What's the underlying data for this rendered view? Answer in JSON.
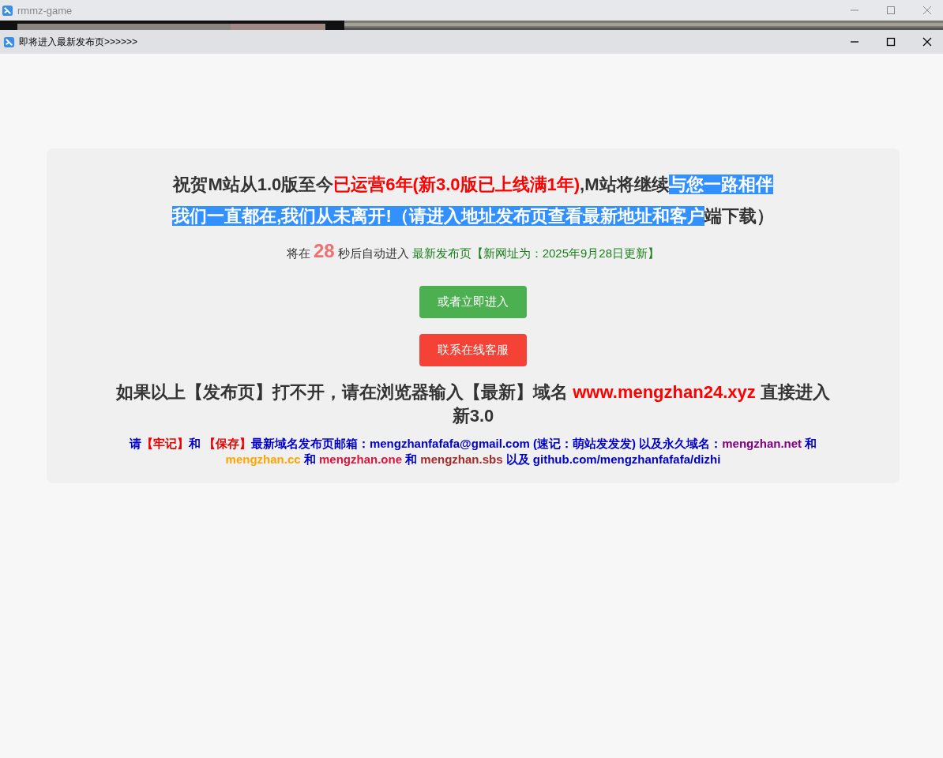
{
  "outer_window": {
    "title": "rmmz-game"
  },
  "window": {
    "title": "即将进入最新发布页>>>>>>"
  },
  "heading": {
    "lines": [
      [
        {
          "text": "祝贺M站从1.0版至今",
          "kind": "plain"
        },
        {
          "text": "已运营6年(新3.0版已上线满1年)",
          "kind": "red"
        },
        {
          "text": ",M站将继续",
          "kind": "plain"
        },
        {
          "text": "与您一路相伴 ",
          "kind": "selected"
        }
      ],
      [
        {
          "text": "我们一直都在,我们从未离开!（请进入地址发布页查看最新地址和客户",
          "kind": "selected"
        },
        {
          "text": "端下载）",
          "kind": "plain"
        }
      ]
    ]
  },
  "countdown": {
    "prefix": "将在",
    "seconds": "28",
    "suffix": "秒后自动进入",
    "link": "最新发布页【新网址为：2025年9月28日更新】"
  },
  "buttons": [
    {
      "label": "或者立即进入",
      "kind": "green"
    },
    {
      "label": "联系在线客服",
      "kind": "red"
    }
  ],
  "fallback": {
    "text": "如果以上【发布页】打不开，请在浏览器输入【最新】域名",
    "domain": "www.mengzhan24.xyz",
    "tail": "直接进入新3.0"
  },
  "notice": [
    {
      "text": "请",
      "color": "#0000cc"
    },
    {
      "text": "【牢记】",
      "color": "#ee0000"
    },
    {
      "text": "和 ",
      "color": "#0000cc"
    },
    {
      "text": "【保存】",
      "color": "#ee0000"
    },
    {
      "text": "最新域名发布页邮箱：mengzhanfafafa@gmail.com (速记：萌站发发发) 以及永久域名：",
      "color": "#0000cc"
    },
    {
      "text": "mengzhan.net",
      "color": "#800080"
    },
    {
      "text": " 和 ",
      "color": "#0000cc"
    },
    {
      "text": "mengzhan.cc",
      "color": "#ffa500"
    },
    {
      "text": " 和 ",
      "color": "#0000cc"
    },
    {
      "text": "mengzhan.one",
      "color": "#dc143c"
    },
    {
      "text": " 和 ",
      "color": "#0000cc"
    },
    {
      "text": "mengzhan.sbs",
      "color": "#a52a2a"
    },
    {
      "text": " 以及 github.com/mengzhanfafafa/dizhi",
      "color": "#0000cc"
    }
  ]
}
